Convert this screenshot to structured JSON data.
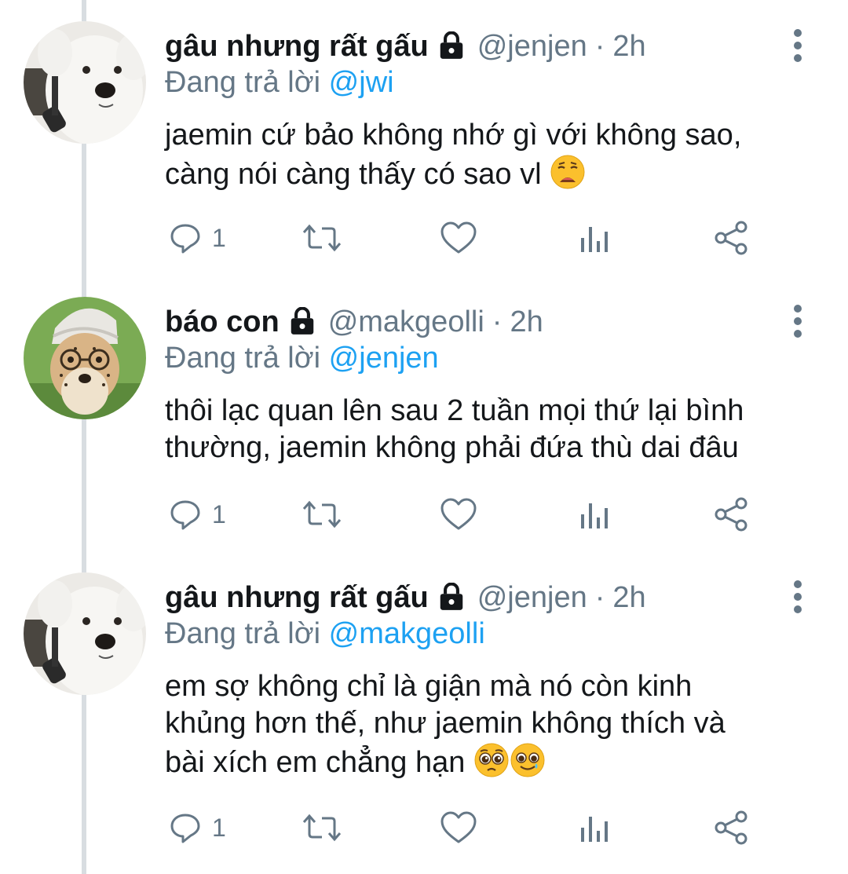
{
  "tweets": [
    {
      "display_name": "gâu nhưng rất gấu",
      "handle": "@jenjen",
      "separator": "·",
      "time": "2h",
      "replying_prefix": "Đang trả lời",
      "replying_to": "@jwi",
      "lines": [
        "jaemin cứ bảo không nhớ gì với không sao,",
        "càng nói càng thấy có sao vl"
      ],
      "emojis": [
        "weary-face"
      ],
      "reply_count": "1",
      "avatar": "white-dog-avatar"
    },
    {
      "display_name": "báo con",
      "handle": "@makgeolli",
      "separator": "·",
      "time": "2h",
      "replying_prefix": "Đang trả lời",
      "replying_to": "@jenjen",
      "lines": [
        "thôi lạc quan lên sau 2 tuần mọi thứ lại bình",
        "thường, jaemin không phải đứa thù dai đâu"
      ],
      "emojis": [],
      "reply_count": "1",
      "avatar": "cheetah-cub-avatar"
    },
    {
      "display_name": "gâu nhưng rất gấu",
      "handle": "@jenjen",
      "separator": "·",
      "time": "2h",
      "replying_prefix": "Đang trả lời",
      "replying_to": "@makgeolli",
      "lines": [
        "em sợ không chỉ là giận mà nó còn kinh",
        "khủng hơn thế, như jaemin không thích và",
        "bài xích em chẳng hạn"
      ],
      "emojis": [
        "pleading-face",
        "smiling-face-with-tear"
      ],
      "reply_count": "1",
      "avatar": "white-dog-avatar"
    }
  ],
  "colors": {
    "text_primary": "#14171a",
    "text_secondary": "#657786",
    "mention": "#1da1f2",
    "thread_line": "#d8dde1"
  }
}
